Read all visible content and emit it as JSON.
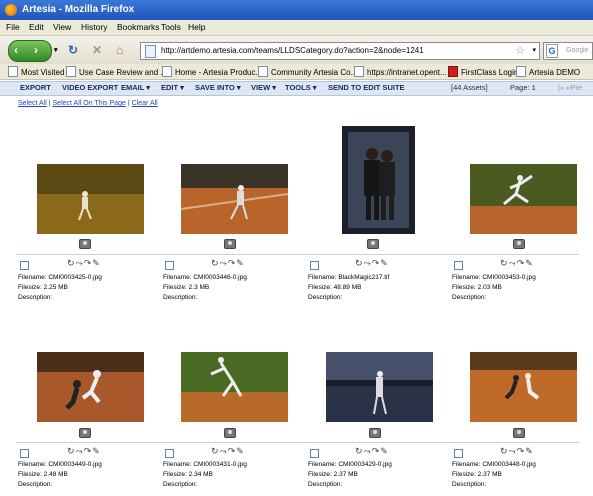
{
  "window": {
    "title": "Artesia - Mozilla Firefox"
  },
  "menu": [
    "File",
    "Edit",
    "View",
    "History",
    "Bookmarks",
    "Tools",
    "Help"
  ],
  "nav": {
    "url": "http://artdemo.artesia.com/teams/LLDSCategory.do?action=2&node=1241",
    "search_placeholder": "Google"
  },
  "bookmarks": [
    "Most Visited",
    "Use Case Review and ...",
    "Home - Artesia Produc...",
    "Community Artesia Co...",
    "https://intranet.opent...",
    "FirstClass Login",
    "Artesia DEMO"
  ],
  "toolbar": {
    "export": "EXPORT",
    "video_export": "VIDEO EXPORT",
    "email": "EMAIL ▾",
    "edit": "EDIT ▾",
    "save_into": "SAVE INTO ▾",
    "view": "VIEW ▾",
    "tools": "TOOLS ▾",
    "send_to_edit_suite": "SEND TO EDIT SUITE",
    "assets": "[44 Assets]",
    "page": "Page: 1",
    "prev": "|« «Pre"
  },
  "selection": {
    "select_all": "Select All",
    "select_all_page": "Select All On This Page",
    "clear_all": "Clear All",
    "sep": " | "
  },
  "labels": {
    "filename": "Filename:",
    "filesize": "Filesize:",
    "description": "Description:"
  },
  "assets": [
    {
      "filename": "CMI0003425-0.jpg",
      "filesize": "2.25 MB"
    },
    {
      "filename": "CMI0003446-0.jpg",
      "filesize": "2.3 MB"
    },
    {
      "filename": "BlackMagic217.tif",
      "filesize": "48.89 MB"
    },
    {
      "filename": "CMI0003453-0.jpg",
      "filesize": "2.03 MB"
    },
    {
      "filename": "CMI0003449-0.jpg",
      "filesize": "2.48 MB"
    },
    {
      "filename": "CMI0003431-0.jpg",
      "filesize": "2.34 MB"
    },
    {
      "filename": "CMI0003429-0.jpg",
      "filesize": "2.37 MB"
    },
    {
      "filename": "CMI0003448-0.jpg",
      "filesize": "2.37 MB"
    }
  ]
}
